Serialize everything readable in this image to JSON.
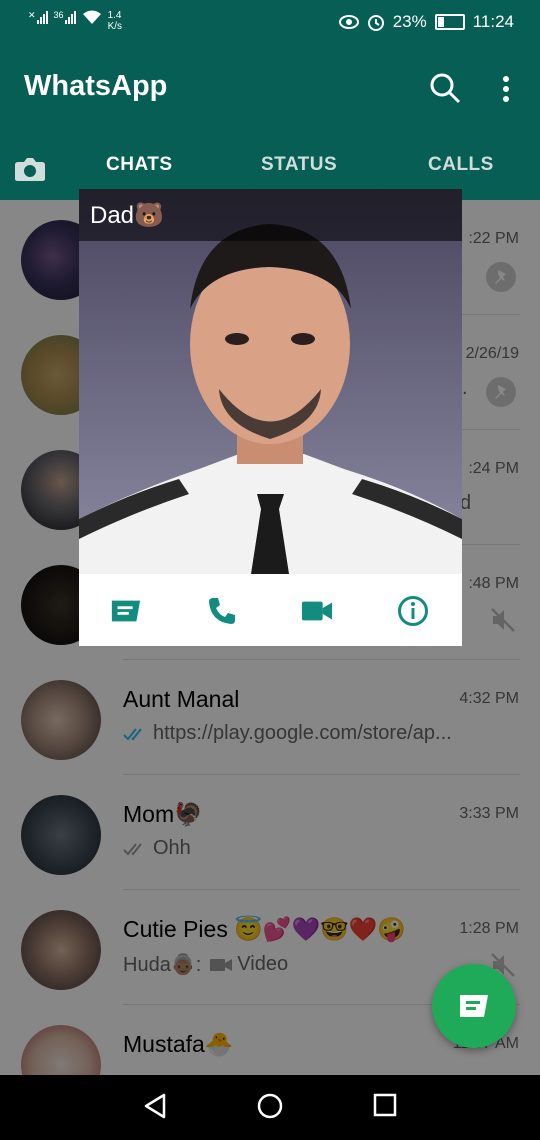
{
  "status_bar": {
    "signal_1": "✕",
    "signal_2": "36",
    "net_speed_value": "1.4",
    "net_speed_unit": "K/s",
    "battery_percent": "23%",
    "battery_level": 0.23,
    "time": "11:24",
    "icons": [
      "signal-icon",
      "wifi-icon",
      "eye-icon",
      "alarm-icon",
      "battery-icon"
    ]
  },
  "app_bar": {
    "title": "WhatsApp",
    "icons": [
      "search-icon",
      "more-vert-icon",
      "camera-icon"
    ]
  },
  "tabs": [
    {
      "label": "CHATS",
      "active": true
    },
    {
      "label": "STATUS",
      "active": false
    },
    {
      "label": "CALLS",
      "active": false
    }
  ],
  "chats": [
    {
      "time": ":22 PM"
    },
    {
      "time": "2/26/19",
      "preview": "."
    },
    {
      "time": ":24 PM",
      "preview": "d"
    },
    {
      "time": ":48 PM"
    },
    {
      "name": "Aunt Manal",
      "time": "4:32 PM",
      "preview": "https://play.google.com/store/ap..."
    },
    {
      "name": "Mom🦃",
      "time": "3:33 PM",
      "preview": "Ohh"
    },
    {
      "name": "Cutie Pies 😇💕💜🤓❤️🤪",
      "time": "1:28 PM",
      "preview_sender": "Huda👵🏽:",
      "preview": "Video"
    },
    {
      "name": "Mustafa🐣",
      "time": "11:37 AM"
    }
  ],
  "popup": {
    "name": "Dad🐻",
    "actions": [
      "message-icon",
      "phone-icon",
      "videocam-icon",
      "info-icon"
    ]
  },
  "colors": {
    "header": "#075e54",
    "accent": "#128c7e",
    "fab": "#1faa59",
    "tick_blue": "#34b7f1"
  },
  "fab": {
    "icon": "new-chat-icon"
  },
  "nav_bar": {
    "icons": [
      "back-icon",
      "home-icon",
      "recents-icon"
    ]
  }
}
